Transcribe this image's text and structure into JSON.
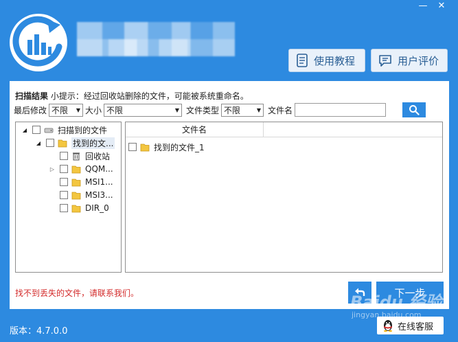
{
  "window": {
    "minimize_glyph": "—",
    "close_glyph": "✕"
  },
  "header": {
    "tutorial_label": "使用教程",
    "review_label": "用户评价"
  },
  "scan": {
    "result_label": "扫描结果",
    "tip_text": "小提示：经过回收站删除的文件，可能被系统重命名。"
  },
  "filters": {
    "modified_label": "最后修改",
    "modified_value": "不限",
    "size_label": "大小",
    "size_value": "不限",
    "type_label": "文件类型",
    "type_value": "不限",
    "name_label": "文件名",
    "name_value": ""
  },
  "tree": {
    "root_label": "扫描到的文件",
    "found_label": "找到的文...",
    "items": [
      {
        "label": "回收站"
      },
      {
        "label": "QQM..."
      },
      {
        "label": "MSI1..."
      },
      {
        "label": "MSI3..."
      },
      {
        "label": "DIR_0"
      }
    ]
  },
  "filelist": {
    "column_name": "文件名",
    "rows": [
      {
        "name": "找到的文件_1"
      }
    ]
  },
  "footer": {
    "contact_text": "找不到丢失的文件，请联系我们。",
    "next_label": "下一步",
    "version_text": "版本：4.7.0.0",
    "service_label": "在线客服",
    "watermark_text": "Baidu 经验",
    "watermark_sub": "jingyan.baidu.com"
  },
  "colors": {
    "brand_blue": "#2d8ae0",
    "link_red": "#d32b2b"
  },
  "icons": {
    "logo": "recovery-logo-icon",
    "tutorial": "document-icon",
    "review": "comment-icon",
    "search": "search-icon",
    "back": "back-arrow-icon",
    "service": "qq-penguin-icon"
  }
}
